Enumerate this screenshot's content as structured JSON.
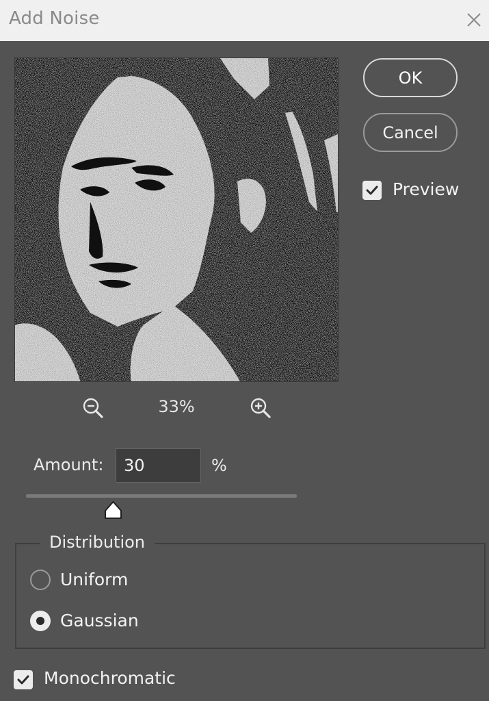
{
  "window": {
    "title": "Add Noise"
  },
  "preview": {
    "zoom": "33%"
  },
  "buttons": {
    "ok": "OK",
    "cancel": "Cancel"
  },
  "options": {
    "preview": {
      "label": "Preview",
      "checked": true
    },
    "monochromatic": {
      "label": "Monochromatic",
      "checked": true
    }
  },
  "amount": {
    "label": "Amount:",
    "value": "30",
    "unit": "%",
    "slider_fraction": 0.3
  },
  "distribution": {
    "legend": "Distribution",
    "options": [
      {
        "label": "Uniform",
        "selected": false
      },
      {
        "label": "Gaussian",
        "selected": true
      }
    ]
  },
  "colors": {
    "background": "#535353",
    "titlebar": "#f0f0f0",
    "field": "#3d3d3d"
  },
  "icons": [
    "close-icon",
    "zoom-out-icon",
    "zoom-in-icon",
    "checkmark-icon"
  ]
}
